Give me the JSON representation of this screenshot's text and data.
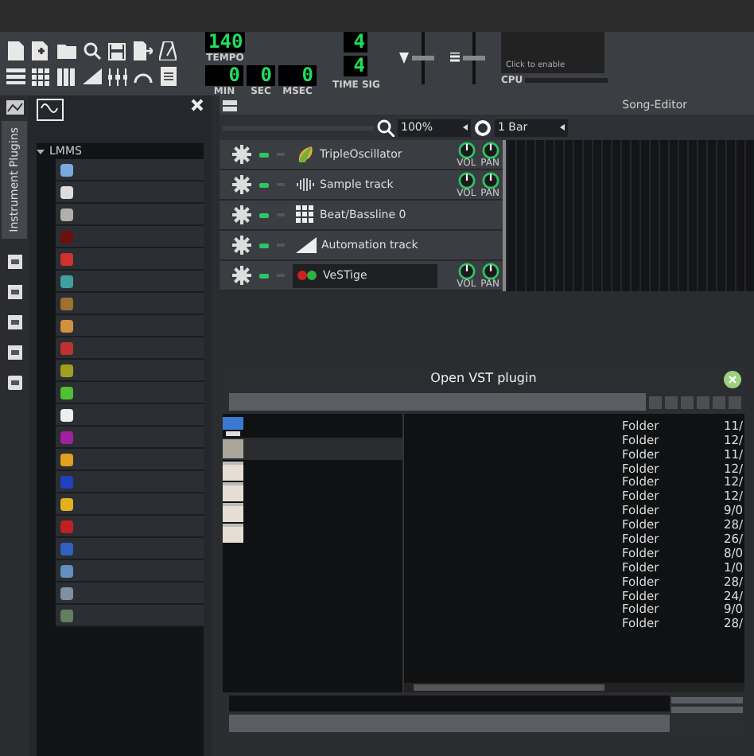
{
  "toolbar": {
    "lcds": [
      {
        "value": "140",
        "label": "TEMPO"
      }
    ],
    "time": [
      {
        "value": "0",
        "label": "MIN"
      },
      {
        "value": "0",
        "label": "SEC"
      },
      {
        "value": "0",
        "label": "MSEC"
      }
    ],
    "time_sig": {
      "numerator": "4",
      "denominator": "4",
      "label": "TIME SIG"
    },
    "master_volume": {
      "level": 0.5
    },
    "master_pitch": {
      "level": 0.5
    },
    "cpu": {
      "hint": "Click to enable",
      "label": "CPU"
    }
  },
  "side_tab": {
    "label": "Instrument Plugins",
    "selected": true
  },
  "plugin_tree": {
    "label": "LMMS",
    "expanded": true,
    "items": [
      {
        "color": "#7aa8e0"
      },
      {
        "color": "#dddddd"
      },
      {
        "color": "#b0b0a8"
      },
      {
        "color": "#6a1010"
      },
      {
        "color": "#d03030"
      },
      {
        "color": "#40a0a0"
      },
      {
        "color": "#a07030"
      },
      {
        "color": "#d09040"
      },
      {
        "color": "#c03030"
      },
      {
        "color": "#a0a020"
      },
      {
        "color": "#50c030"
      },
      {
        "color": "#eeeeee"
      },
      {
        "color": "#a020a0"
      },
      {
        "color": "#e0a020"
      },
      {
        "color": "#2040c0"
      },
      {
        "color": "#e0b020"
      },
      {
        "color": "#c02020"
      },
      {
        "color": "#3060c0"
      },
      {
        "color": "#6090c0"
      },
      {
        "color": "#8090a0"
      },
      {
        "color": "#608060"
      }
    ]
  },
  "song_editor": {
    "title": "Song-Editor",
    "zoom": "100%",
    "quantize": "1 Bar",
    "tracks": [
      {
        "kind": "instrument",
        "name": "TripleOscillator",
        "vol": "VOL",
        "pan": "PAN",
        "selected": false
      },
      {
        "kind": "sample",
        "name": "Sample track",
        "vol": "VOL",
        "pan": "PAN",
        "selected": false
      },
      {
        "kind": "beat",
        "name": "Beat/Bassline 0",
        "selected": false
      },
      {
        "kind": "automation",
        "name": "Automation track",
        "selected": false
      },
      {
        "kind": "vst",
        "name": "VeSTige",
        "vol": "VOL",
        "pan": "PAN",
        "selected": true
      }
    ]
  },
  "dialog": {
    "title": "Open VST plugin",
    "files": [
      {
        "type": "Folder",
        "date": "11/"
      },
      {
        "type": "Folder",
        "date": "12/"
      },
      {
        "type": "Folder",
        "date": "11/"
      },
      {
        "type": "Folder",
        "date": "12/"
      },
      {
        "type": "Folder",
        "date": "12/"
      },
      {
        "type": "Folder",
        "date": "12/"
      },
      {
        "type": "Folder",
        "date": "9/0"
      },
      {
        "type": "Folder",
        "date": "28/"
      },
      {
        "type": "Folder",
        "date": "26/"
      },
      {
        "type": "Folder",
        "date": "8/0"
      },
      {
        "type": "Folder",
        "date": "1/0"
      },
      {
        "type": "Folder",
        "date": "28/"
      },
      {
        "type": "Folder",
        "date": "24/"
      },
      {
        "type": "Folder",
        "date": "9/0"
      },
      {
        "type": "Folder",
        "date": "28/"
      }
    ]
  }
}
